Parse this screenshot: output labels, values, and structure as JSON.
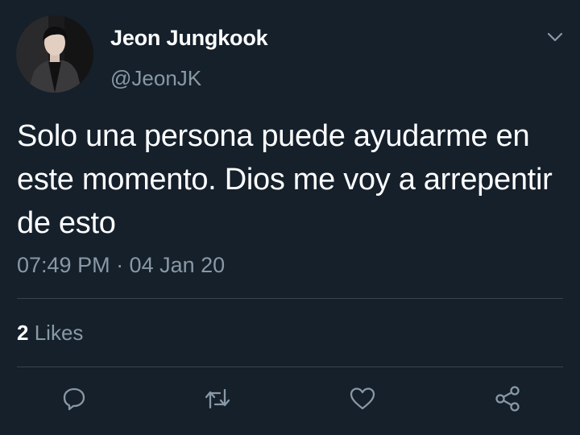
{
  "author": {
    "display_name": "Jeon Jungkook",
    "handle": "@JeonJK"
  },
  "tweet": {
    "text": "Solo una persona puede ayudarme en este momento. Dios me voy a arrepentir de esto",
    "timestamp": "07:49 PM · 04 Jan 20"
  },
  "stats": {
    "likes_count": "2",
    "likes_label": "Likes"
  },
  "actions": {
    "reply_icon": "reply-icon",
    "retweet_icon": "retweet-icon",
    "like_icon": "heart-icon",
    "share_icon": "share-icon"
  },
  "colors": {
    "background": "#15202b",
    "primary_text": "#ffffff",
    "secondary_text": "#8899a6",
    "divider": "#38444d"
  }
}
